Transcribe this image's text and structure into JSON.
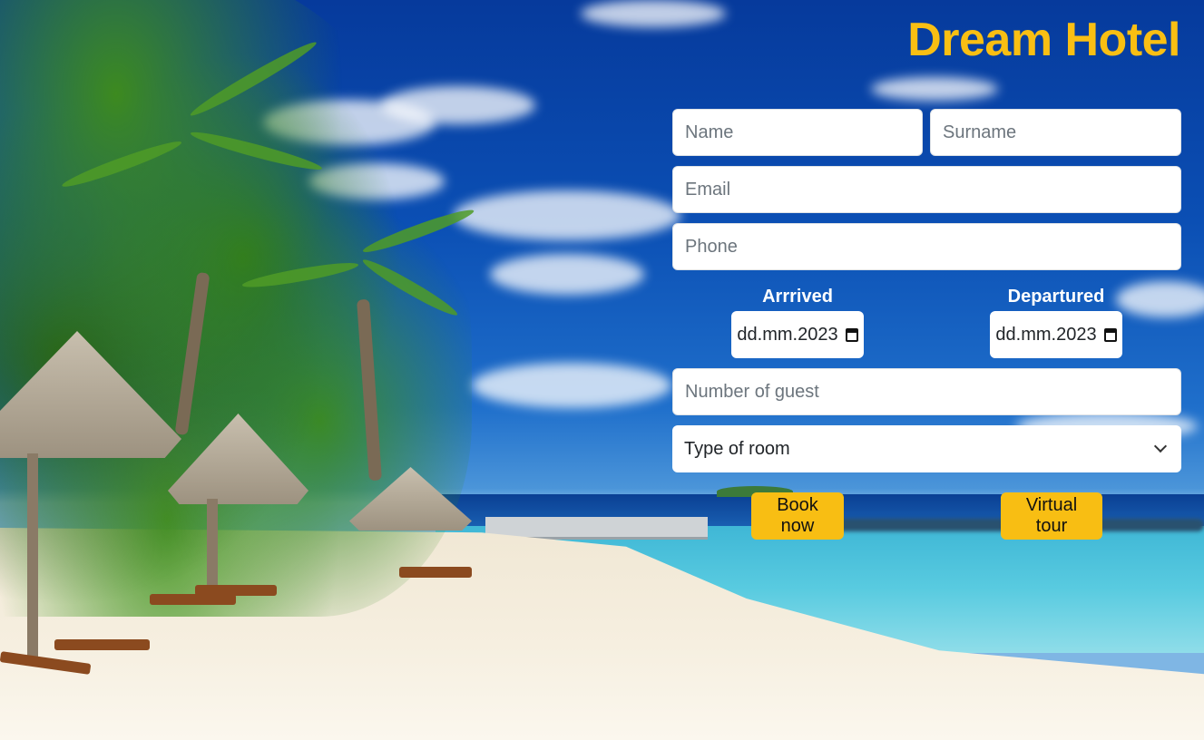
{
  "header": {
    "title": "Dream Hotel"
  },
  "form": {
    "name_placeholder": "Name",
    "surname_placeholder": "Surname",
    "email_placeholder": "Email",
    "phone_placeholder": "Phone",
    "arrived_label": "Arrrived",
    "arrived_value": "dd.mm.2023",
    "departured_label": "Departured",
    "departured_value": "dd.mm.2023",
    "guests_placeholder": "Number of guest",
    "room_type_selected": "Type of room",
    "book_label": "Book now",
    "tour_label": "Virtual tour"
  },
  "colors": {
    "accent": "#f8be13",
    "title": "#f9bf13",
    "sky": "#0b4fb4",
    "sea": "#59cbe0"
  },
  "icons": {
    "date_picker": "calendar-icon",
    "select": "chevron-down-icon"
  }
}
